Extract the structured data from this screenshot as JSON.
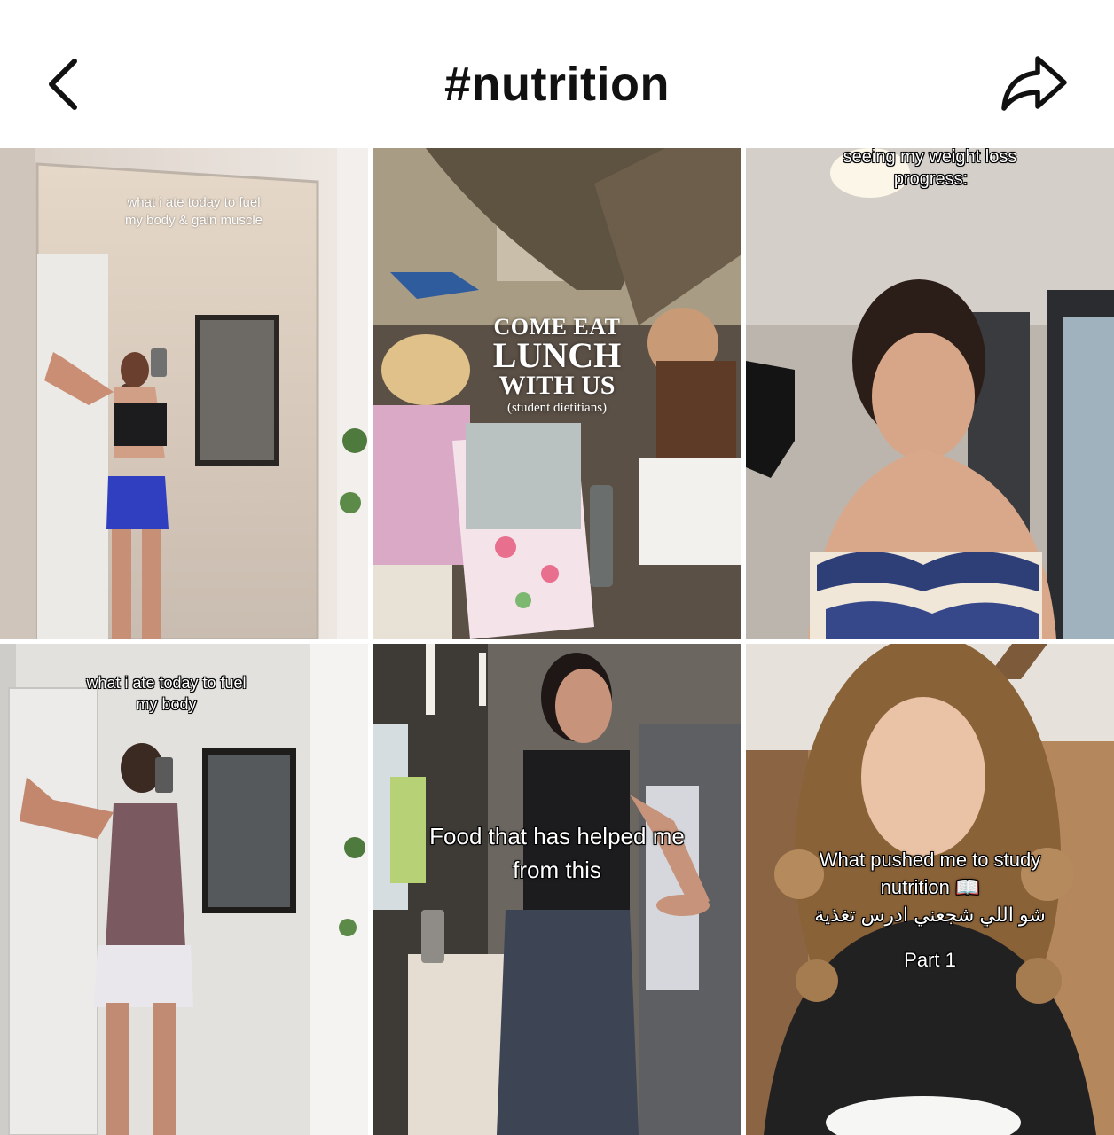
{
  "header": {
    "title": "#nutrition",
    "back_icon": "chevron-left-icon",
    "share_icon": "share-arrow-icon"
  },
  "videos": [
    {
      "caption_lines": [
        "what i ate today to fuel",
        "my body & gain muscle"
      ]
    },
    {
      "caption_lines": [
        "COME EAT",
        "LUNCH",
        "WITH US",
        "(student dietitians)"
      ]
    },
    {
      "caption_lines": [
        "seeing my weight loss",
        "progress:"
      ]
    },
    {
      "caption_lines": [
        "what i ate today to fuel",
        "my body"
      ]
    },
    {
      "caption_lines": [
        "Food that has helped me",
        "from this"
      ]
    },
    {
      "caption_lines": [
        "What pushed me to study",
        "nutrition 📖",
        "شو اللي شجعني ادرس تغذية",
        "Part 1"
      ]
    }
  ]
}
